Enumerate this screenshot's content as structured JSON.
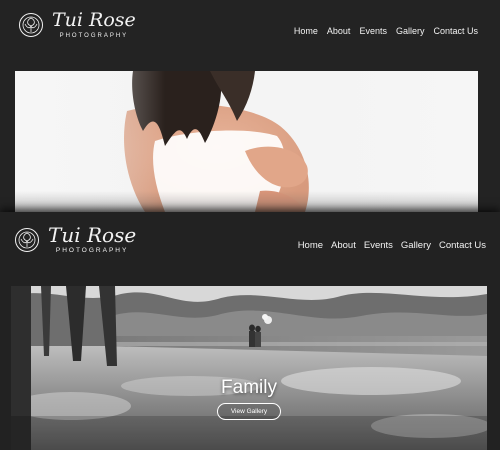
{
  "brand": {
    "name": "Tui Rose",
    "tagline": "PHOTOGRAPHY"
  },
  "nav": {
    "items": [
      {
        "label": "Home"
      },
      {
        "label": "About"
      },
      {
        "label": "Events"
      },
      {
        "label": "Gallery"
      },
      {
        "label": "Contact Us"
      }
    ]
  },
  "hero_family": {
    "title": "Family",
    "button_label": "View Gallery"
  },
  "colors": {
    "header_bg": "#232323",
    "text": "#f2f2f2"
  }
}
